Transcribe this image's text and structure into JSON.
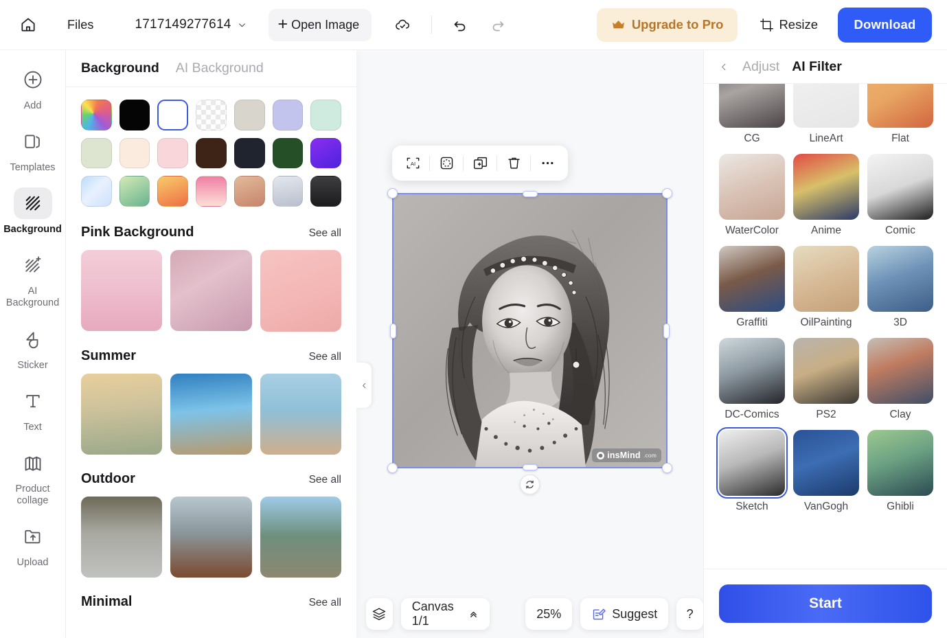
{
  "header": {
    "home_icon": "home-icon",
    "files_label": "Files",
    "filename": "1717149277614",
    "open_image_label": "Open Image",
    "cloud_icon": "cloud-saved-icon",
    "undo_icon": "undo-icon",
    "redo_icon": "redo-icon",
    "upgrade_label": "Upgrade to Pro",
    "upgrade_icon": "crown-icon",
    "resize_label": "Resize",
    "resize_icon": "crop-icon",
    "download_label": "Download",
    "accent_blue": "#2f5cf6",
    "upgrade_bg": "#fbeed9",
    "upgrade_text": "#b5762a"
  },
  "rail": {
    "items": [
      {
        "label": "Add",
        "icon": "plus-circle-icon",
        "active": false
      },
      {
        "label": "Templates",
        "icon": "templates-icon",
        "active": false
      },
      {
        "label": "Background",
        "icon": "background-hatch-icon",
        "active": true
      },
      {
        "label": "AI Background",
        "icon": "ai-background-sparkle-icon",
        "active": false
      },
      {
        "label": "Sticker",
        "icon": "sticker-icon",
        "active": false
      },
      {
        "label": "Text",
        "icon": "text-t-icon",
        "active": false
      },
      {
        "label": "Product collage",
        "icon": "product-collage-icon",
        "active": false
      },
      {
        "label": "Upload",
        "icon": "upload-folder-icon",
        "active": false
      }
    ]
  },
  "panel": {
    "tabs": [
      {
        "label": "Background",
        "active": true
      },
      {
        "label": "AI Background",
        "active": false
      }
    ],
    "swatches": [
      {
        "name": "rainbow-picker",
        "css": "conic-gradient(from 200deg at 40% 45%, #4fb5e8, #66d46a, #ffe04f, #f07a4f, #e05c8a, #a05cd8, #4fb5e8)",
        "selected": false
      },
      {
        "name": "black",
        "css": "#050505",
        "selected": false
      },
      {
        "name": "white",
        "css": "#ffffff",
        "selected": true
      },
      {
        "name": "transparent",
        "css": "repeating-conic-gradient(#e9e9e9 0% 25%, #ffffff 0% 50%) 0 0/14px 14px",
        "selected": false
      },
      {
        "name": "warm-grey",
        "css": "#d8d5cd",
        "selected": false
      },
      {
        "name": "periwinkle",
        "css": "#c2c4ee",
        "selected": false
      },
      {
        "name": "mint",
        "css": "#cfeade",
        "selected": false
      },
      {
        "name": "sage",
        "css": "#dde4cf",
        "selected": false
      },
      {
        "name": "cream",
        "css": "#fbeade",
        "selected": false
      },
      {
        "name": "blush-pink",
        "css": "#f9d6da",
        "selected": false
      },
      {
        "name": "dark-brown",
        "css": "#3e2317",
        "selected": false
      },
      {
        "name": "midnight-navy",
        "css": "#20242f",
        "selected": false
      },
      {
        "name": "forest-green",
        "css": "#255027",
        "selected": false
      },
      {
        "name": "violet",
        "css": "linear-gradient(150deg,#8a2ef0,#4e22dd)",
        "selected": false
      },
      {
        "name": "sky-blue-gradient",
        "css": "linear-gradient(135deg,#bddcfb,#e8f1fe 45%,#cfe1fb)",
        "selected": false
      },
      {
        "name": "green-gradient",
        "css": "linear-gradient(150deg,#d5e9b6,#67b390)",
        "selected": false
      },
      {
        "name": "orange-gradient",
        "css": "linear-gradient(160deg,#f7cc6b,#ef6f45)",
        "selected": false
      },
      {
        "name": "pink-gradient",
        "css": "linear-gradient(180deg,#f07fa5,#fbe0d6)",
        "selected": false
      },
      {
        "name": "terracotta-gradient",
        "css": "linear-gradient(160deg,#e2bb9a,#c6846c)",
        "selected": false
      },
      {
        "name": "silver-gradient",
        "css": "linear-gradient(170deg,#e4e7ee,#b9bfcd)",
        "selected": false
      },
      {
        "name": "charcoal-gradient",
        "css": "linear-gradient(180deg,#3e3e40,#1c1c1e)",
        "selected": false
      }
    ],
    "sections": [
      {
        "title": "Pink Background",
        "see_all": "See all",
        "thumbs": [
          {
            "name": "pink-petals-podium",
            "css": "linear-gradient(180deg,#f3cdd8 0%,#eec0cf 45%,#e7a9bd 100%)"
          },
          {
            "name": "pink-curtain-window",
            "css": "linear-gradient(150deg,#d4a9b6 0%,#e3c0cb 40%,#c79aae 100%)"
          },
          {
            "name": "pink-tulips",
            "css": "linear-gradient(160deg,#f6c4c2 0%,#f3b6b4 60%,#eca9a8 100%)"
          }
        ]
      },
      {
        "title": "Summer",
        "see_all": "See all",
        "thumbs": [
          {
            "name": "tropical-beach-podium",
            "css": "linear-gradient(175deg,#e8cf9c 0%,#cfc39c 40%,#9aa88a 100%)"
          },
          {
            "name": "pool-water-deck",
            "css": "linear-gradient(175deg,#2f7fc0 0%,#7dc3e8 45%,#b89a6d 100%)"
          },
          {
            "name": "sand-sea-sky",
            "css": "linear-gradient(180deg,#a9cfe4 0%,#8fc0d8 45%,#cfae8c 100%)"
          }
        ]
      },
      {
        "title": "Outdoor",
        "see_all": "See all",
        "thumbs": [
          {
            "name": "wet-cobblestone-street",
            "css": "linear-gradient(180deg,#6e6a58 0%,#a9a9a2 45%,#c0c2bf 100%)"
          },
          {
            "name": "coastal-cliff-deck",
            "css": "linear-gradient(180deg,#b8c6cd 0%,#8c9aa0 42%,#7a4a30 100%)"
          },
          {
            "name": "mountain-forest-ledge",
            "css": "linear-gradient(180deg,#9ecbe8 0%,#6f8f7e 48%,#8d8770 100%)"
          }
        ]
      },
      {
        "title": "Minimal",
        "see_all": "See all",
        "thumbs": []
      }
    ]
  },
  "canvas": {
    "collapse_icon": "chevron-left-icon",
    "toolbar": [
      {
        "name": "ai-tool-button",
        "icon": "ai-brackets-icon"
      },
      {
        "name": "cutout-tool-button",
        "icon": "cutout-dashed-circle-icon"
      },
      {
        "name": "duplicate-tool-button",
        "icon": "duplicate-plus-icon"
      },
      {
        "name": "delete-tool-button",
        "icon": "trash-icon"
      },
      {
        "name": "more-tool-button",
        "icon": "more-dots-icon"
      }
    ],
    "image_alt": "pencil-sketch-portrait",
    "watermark": "insMind",
    "watermark_suffix": ".com",
    "rotate_icon": "rotate-icon"
  },
  "bottom_bar": {
    "layers_icon": "layers-icon",
    "canvas_label": "Canvas 1/1",
    "canvas_chevron": "chevron-up-icon",
    "zoom_label": "25%",
    "suggest_label": "Suggest",
    "suggest_icon": "suggest-note-icon",
    "help_label": "?"
  },
  "right_panel": {
    "back_icon": "chevron-left-icon",
    "tabs": [
      {
        "label": "Adjust",
        "active": false
      },
      {
        "label": "AI Filter",
        "active": true
      }
    ],
    "filters": [
      {
        "label": "CG",
        "css": "linear-gradient(160deg,#6c6a6d 0%,#a9a3a1 40%,#4c4446 100%)",
        "selected": false
      },
      {
        "label": "LineArt",
        "css": "linear-gradient(160deg,#f2f2f2,#e6e6e6)",
        "selected": false
      },
      {
        "label": "Flat",
        "css": "linear-gradient(150deg,#f0b170 0%,#e8a663 45%,#d2653f 100%)",
        "selected": false
      },
      {
        "label": "WaterColor",
        "css": "linear-gradient(160deg,#ece8e4 0%,#d9c3b6 50%,#c7a594 100%)",
        "selected": false
      },
      {
        "label": "Anime",
        "css": "linear-gradient(160deg,#e24a46 0%,#d8c06a 45%,#2b3a68 100%)",
        "selected": false
      },
      {
        "label": "Comic",
        "css": "linear-gradient(160deg,#f4f4f4 0%,#d8d8d8 50%,#1d1d1d 100%)",
        "selected": false
      },
      {
        "label": "Graffiti",
        "css": "linear-gradient(160deg,#cfc9c2 0%,#7a5a48 45%,#2c4c84 100%)",
        "selected": false
      },
      {
        "label": "OilPainting",
        "css": "linear-gradient(160deg,#e6dcc0 0%,#d7ba97 50%,#c3a078 100%)",
        "selected": false
      },
      {
        "label": "3D",
        "css": "linear-gradient(160deg,#b9d2e0 0%,#6f93b8 45%,#3d5d86 100%)",
        "selected": false
      },
      {
        "label": "DC-Comics",
        "css": "linear-gradient(160deg,#cfd9dd 0%,#8e9aa2 45%,#24252a 100%)",
        "selected": false
      },
      {
        "label": "PS2",
        "css": "linear-gradient(160deg,#b9b4ad 0%,#c8ae85 45%,#3a3833 100%)",
        "selected": false
      },
      {
        "label": "Clay",
        "css": "linear-gradient(160deg,#c4bfb8 0%,#c07c60 40%,#3f4e68 100%)",
        "selected": false
      },
      {
        "label": "Sketch",
        "css": "linear-gradient(160deg,#efefef 0%,#b8b8b8 45%,#2b2b2b 100%)",
        "selected": true
      },
      {
        "label": "VanGogh",
        "css": "linear-gradient(160deg,#2a5296 0%,#3d6db3 45%,#1b3a6b 100%)",
        "selected": false
      },
      {
        "label": "Ghibli",
        "css": "linear-gradient(160deg,#9dc98f 0%,#6ba083 45%,#2b4a52 100%)",
        "selected": false
      }
    ],
    "start_label": "Start"
  }
}
